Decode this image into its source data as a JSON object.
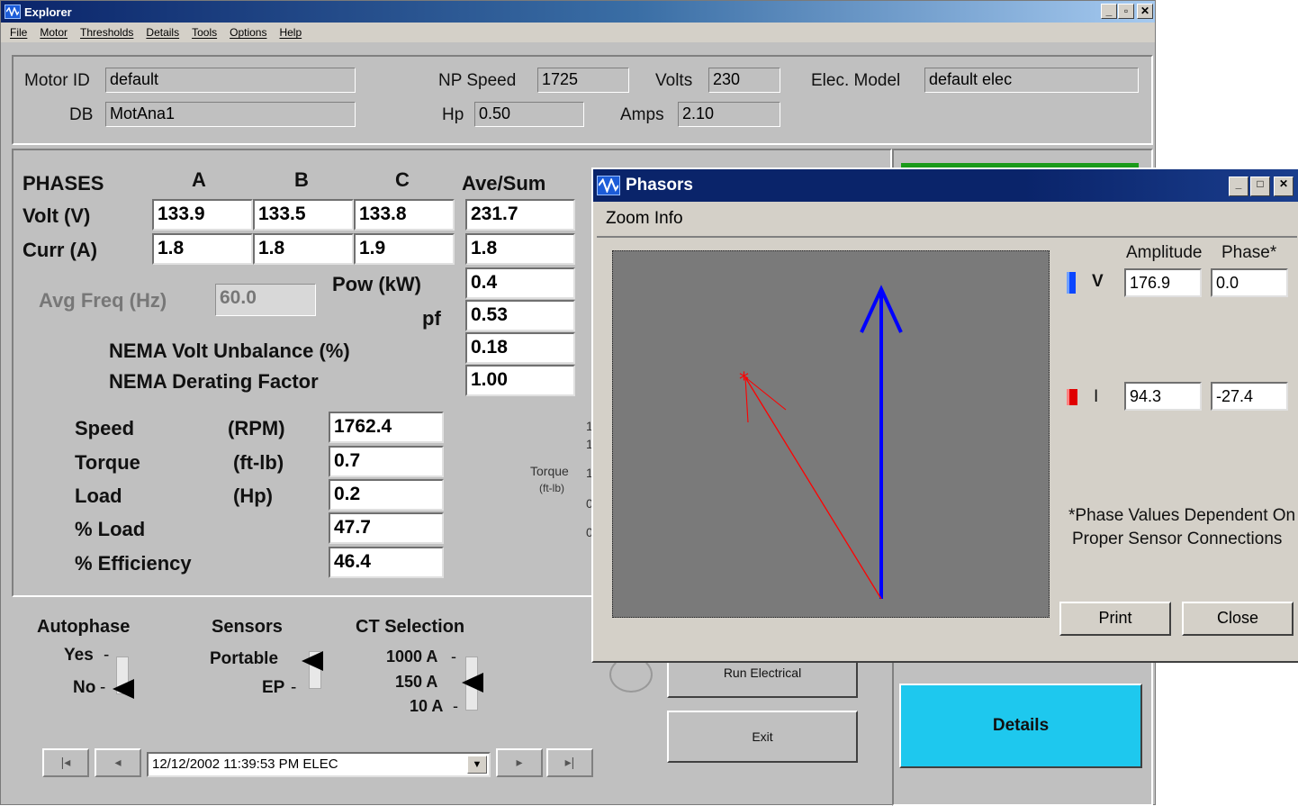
{
  "main": {
    "title": "Explorer",
    "menu": [
      "File",
      "Motor",
      "Thresholds",
      "Details",
      "Tools",
      "Options",
      "Help"
    ],
    "header": {
      "motor_id_label": "Motor ID",
      "motor_id": "default",
      "db_label": "DB",
      "db": "MotAna1",
      "np_speed_label": "NP Speed",
      "np_speed": "1725",
      "hp_label": "Hp",
      "hp": "0.50",
      "volts_label": "Volts",
      "volts": "230",
      "amps_label": "Amps",
      "amps": "2.10",
      "elec_model_label": "Elec. Model",
      "elec_model": "default elec"
    },
    "phases": {
      "heading": "PHASES",
      "col_a": "A",
      "col_b": "B",
      "col_c": "C",
      "col_avg": "Ave/Sum",
      "volt_label": "Volt (V)",
      "curr_label": "Curr (A)",
      "volt": [
        "133.9",
        "133.5",
        "133.8",
        "231.7"
      ],
      "curr": [
        "1.8",
        "1.8",
        "1.9",
        "1.8"
      ],
      "avg_freq_label": "Avg Freq (Hz)",
      "avg_freq": "60.0",
      "pow_label": "Pow (kW)",
      "pow": "0.4",
      "pf_label": "pf",
      "pf": "0.53",
      "nema_unbalance_label": "NEMA Volt Unbalance (%)",
      "nema_unbalance": "0.18",
      "nema_derating_label": "NEMA Derating Factor",
      "nema_derating": "1.00"
    },
    "mech": [
      {
        "name": "Speed",
        "unit": "(RPM)",
        "value": "1762.4"
      },
      {
        "name": "Torque",
        "unit": "(ft-lb)",
        "value": "0.7"
      },
      {
        "name": "Load",
        "unit": "(Hp)",
        "value": "0.2"
      },
      {
        "name": "% Load",
        "unit": "",
        "value": "47.7"
      },
      {
        "name": "% Efficiency",
        "unit": "",
        "value": "46.4"
      }
    ],
    "torque_axis_label": "Torque",
    "torque_axis_unit": "(ft-lb)",
    "axis_stub_digits": [
      "1",
      "1",
      "1",
      "0",
      "0"
    ],
    "autophase": {
      "heading": "Autophase",
      "yes": "Yes",
      "no": "No"
    },
    "sensors": {
      "heading": "Sensors",
      "portable": "Portable",
      "ep": "EP"
    },
    "ct": {
      "heading": "CT Selection",
      "opt1": "1000 A",
      "opt2": "150 A",
      "opt3": "10 A"
    },
    "nav": {
      "first": "|◂",
      "prev": "◂",
      "record": "12/12/2002 11:39:53 PM ELEC",
      "next": "▸",
      "last": "▸|"
    },
    "buttons": {
      "run_electrical": "Run Electrical",
      "exit": "Exit",
      "details": "Details"
    },
    "colors": {
      "details_button": "#1ec8ee",
      "status_bar": "#1a9a1a"
    }
  },
  "phasors": {
    "title": "Phasors",
    "menu": "Zoom Info",
    "amplitude_header": "Amplitude",
    "phase_header": "Phase*",
    "v_label": "V",
    "v_amplitude": "176.9",
    "v_phase": "0.0",
    "i_label": "I",
    "i_amplitude": "94.3",
    "i_phase": "-27.4",
    "note_line1": "*Phase Values Dependent On",
    "note_line2": "Proper Sensor Connections",
    "print_label": "Print",
    "close_label": "Close",
    "v_color": "#0000ff",
    "i_color": "#ff0000"
  }
}
